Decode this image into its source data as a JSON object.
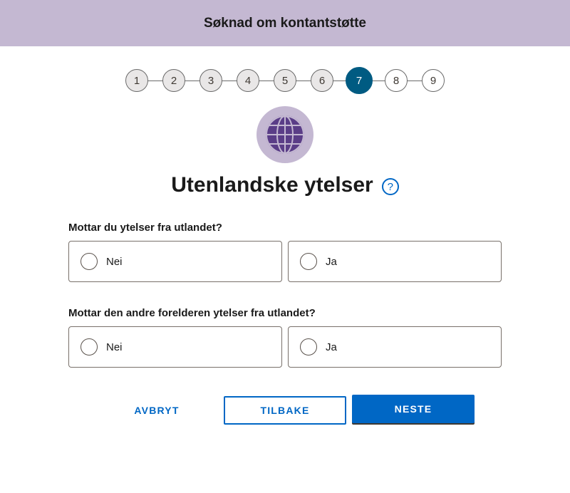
{
  "banner": {
    "title": "Søknad om kontantstøtte"
  },
  "stepper": {
    "steps": [
      "1",
      "2",
      "3",
      "4",
      "5",
      "6",
      "7",
      "8",
      "9"
    ],
    "current": 7
  },
  "page": {
    "icon": "globe-icon",
    "title": "Utenlandske ytelser",
    "help_icon_glyph": "?"
  },
  "questions": [
    {
      "label": "Mottar du ytelser fra utlandet?",
      "options": [
        "Nei",
        "Ja"
      ],
      "selected": null
    },
    {
      "label": "Mottar den andre forelderen ytelser fra utlandet?",
      "options": [
        "Nei",
        "Ja"
      ],
      "selected": null
    }
  ],
  "buttons": {
    "cancel": "AVBRYT",
    "back": "TILBAKE",
    "next": "NESTE"
  },
  "colors": {
    "banner_bg": "#c4b8d2",
    "active_step": "#005b82",
    "primary": "#0067c5",
    "globe": "#5a3d87"
  }
}
